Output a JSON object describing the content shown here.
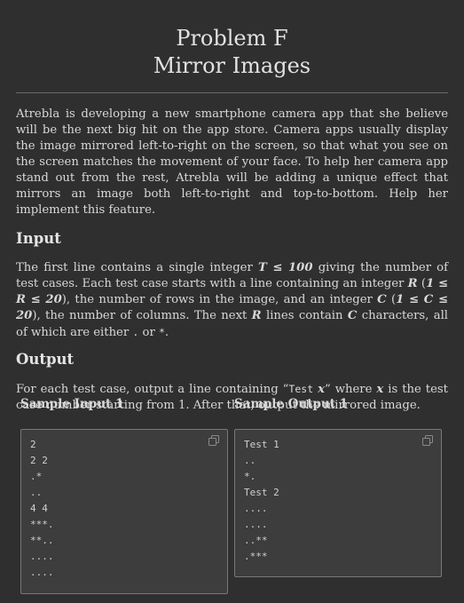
{
  "title": {
    "line1": "Problem F",
    "line2": "Mirror Images"
  },
  "intro": "Atrebla is developing a new smartphone camera app that she believe will be the next big hit on the app store. Camera apps usually display the image mirrored left-to-right on the screen, so that what you see on the screen matches the movement of your face. To help her camera app stand out from the rest, Atrebla will be adding a unique effect that mirrors an image both left-to-right and top-to-bottom. Help her implement this feature.",
  "input": {
    "heading": "Input",
    "t1": "The first line contains a single integer ",
    "m_T": "T ≤ 100",
    "t2": " giving the number of test cases. Each test case starts with a line containing an integer ",
    "m_R": "R",
    "t3": " (",
    "m_Rrange": "1 ≤ R ≤ 20",
    "t4": "), the number of rows in the image, and an integer ",
    "m_C": "C",
    "t5": " (",
    "m_Crange": "1 ≤ C ≤ 20",
    "t6": "), the number of columns. The next ",
    "m_R2": "R",
    "t7": " lines contain ",
    "m_C2": "C",
    "t8": " characters, all of which are either ",
    "c_dot": ".",
    "t9": " or ",
    "c_star": "*",
    "t10": "."
  },
  "output": {
    "heading": "Output",
    "t1": "For each test case, output a line containing “",
    "c_test": "Test",
    "m_x": "x",
    "t2": "” where ",
    "m_x2": "x",
    "t3": " is the test case number starting from 1. After that, output the mirrored image."
  },
  "sample_input": {
    "label": "Sample Input 1",
    "lines": [
      "2",
      "2 2",
      ".*",
      "..",
      "4 4",
      "***.",
      "**..",
      "....",
      "...."
    ]
  },
  "sample_output": {
    "label": "Sample Output 1",
    "lines": [
      "Test 1",
      "..",
      "*.",
      "Test 2",
      "....",
      "....",
      "..**",
      ".***"
    ]
  },
  "icons": {
    "copy": "copy-icon"
  }
}
